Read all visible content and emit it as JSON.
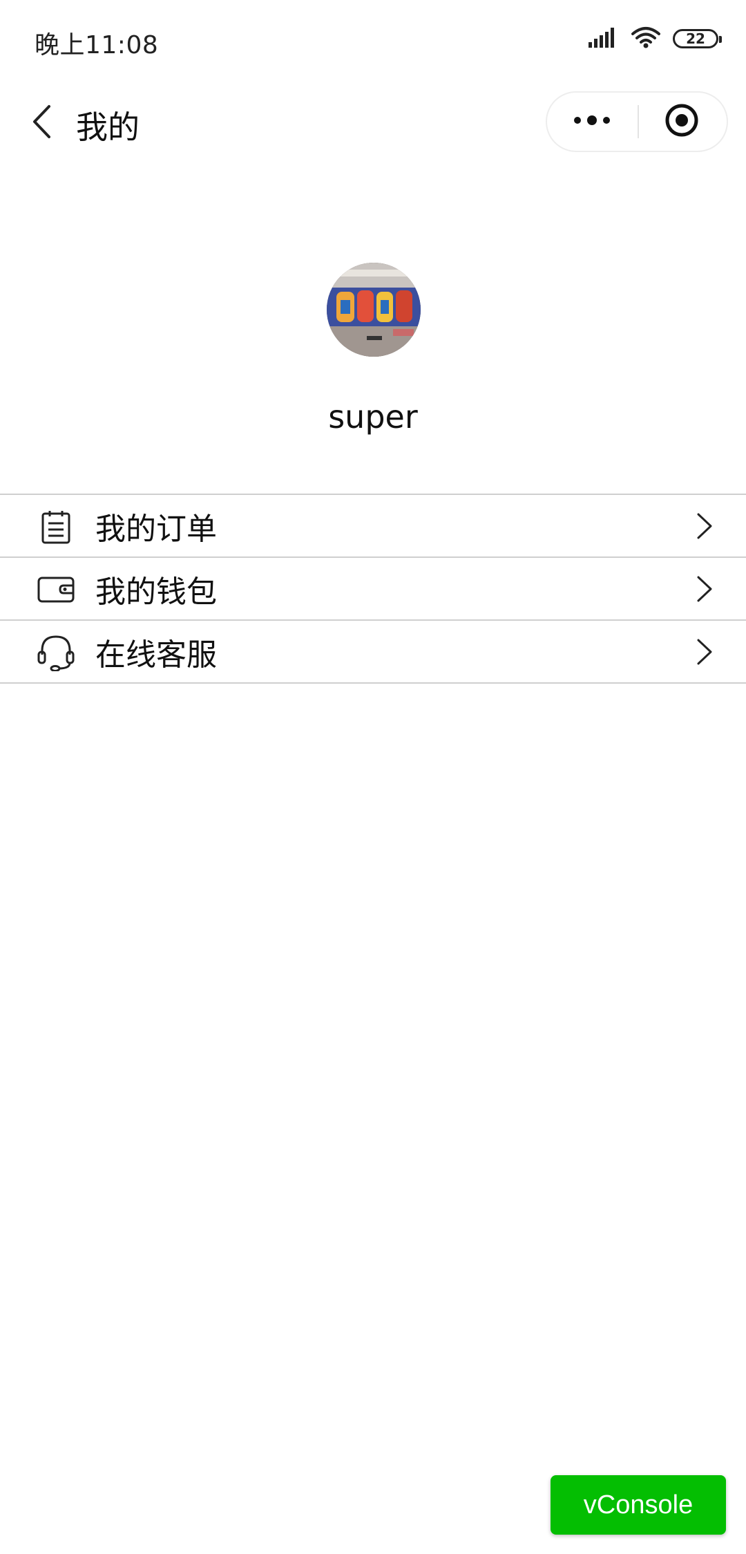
{
  "status_bar": {
    "time": "晚上11:08",
    "battery_level": "22",
    "icons": [
      "signal-icon",
      "wifi-icon",
      "battery-icon"
    ]
  },
  "nav": {
    "title": "我的",
    "back_icon": "chevron-left-icon",
    "more_icon": "more-dots-icon",
    "close_icon": "target-close-icon"
  },
  "profile": {
    "username": "super",
    "avatar_icon": "graffiti-photo-avatar"
  },
  "menu": {
    "items": [
      {
        "label": "我的订单",
        "icon": "clipboard-icon"
      },
      {
        "label": "我的钱包",
        "icon": "wallet-icon"
      },
      {
        "label": "在线客服",
        "icon": "headset-icon"
      }
    ],
    "chevron_icon": "chevron-right-icon"
  },
  "debug": {
    "vconsole_label": "vConsole",
    "color": "#04be02"
  }
}
